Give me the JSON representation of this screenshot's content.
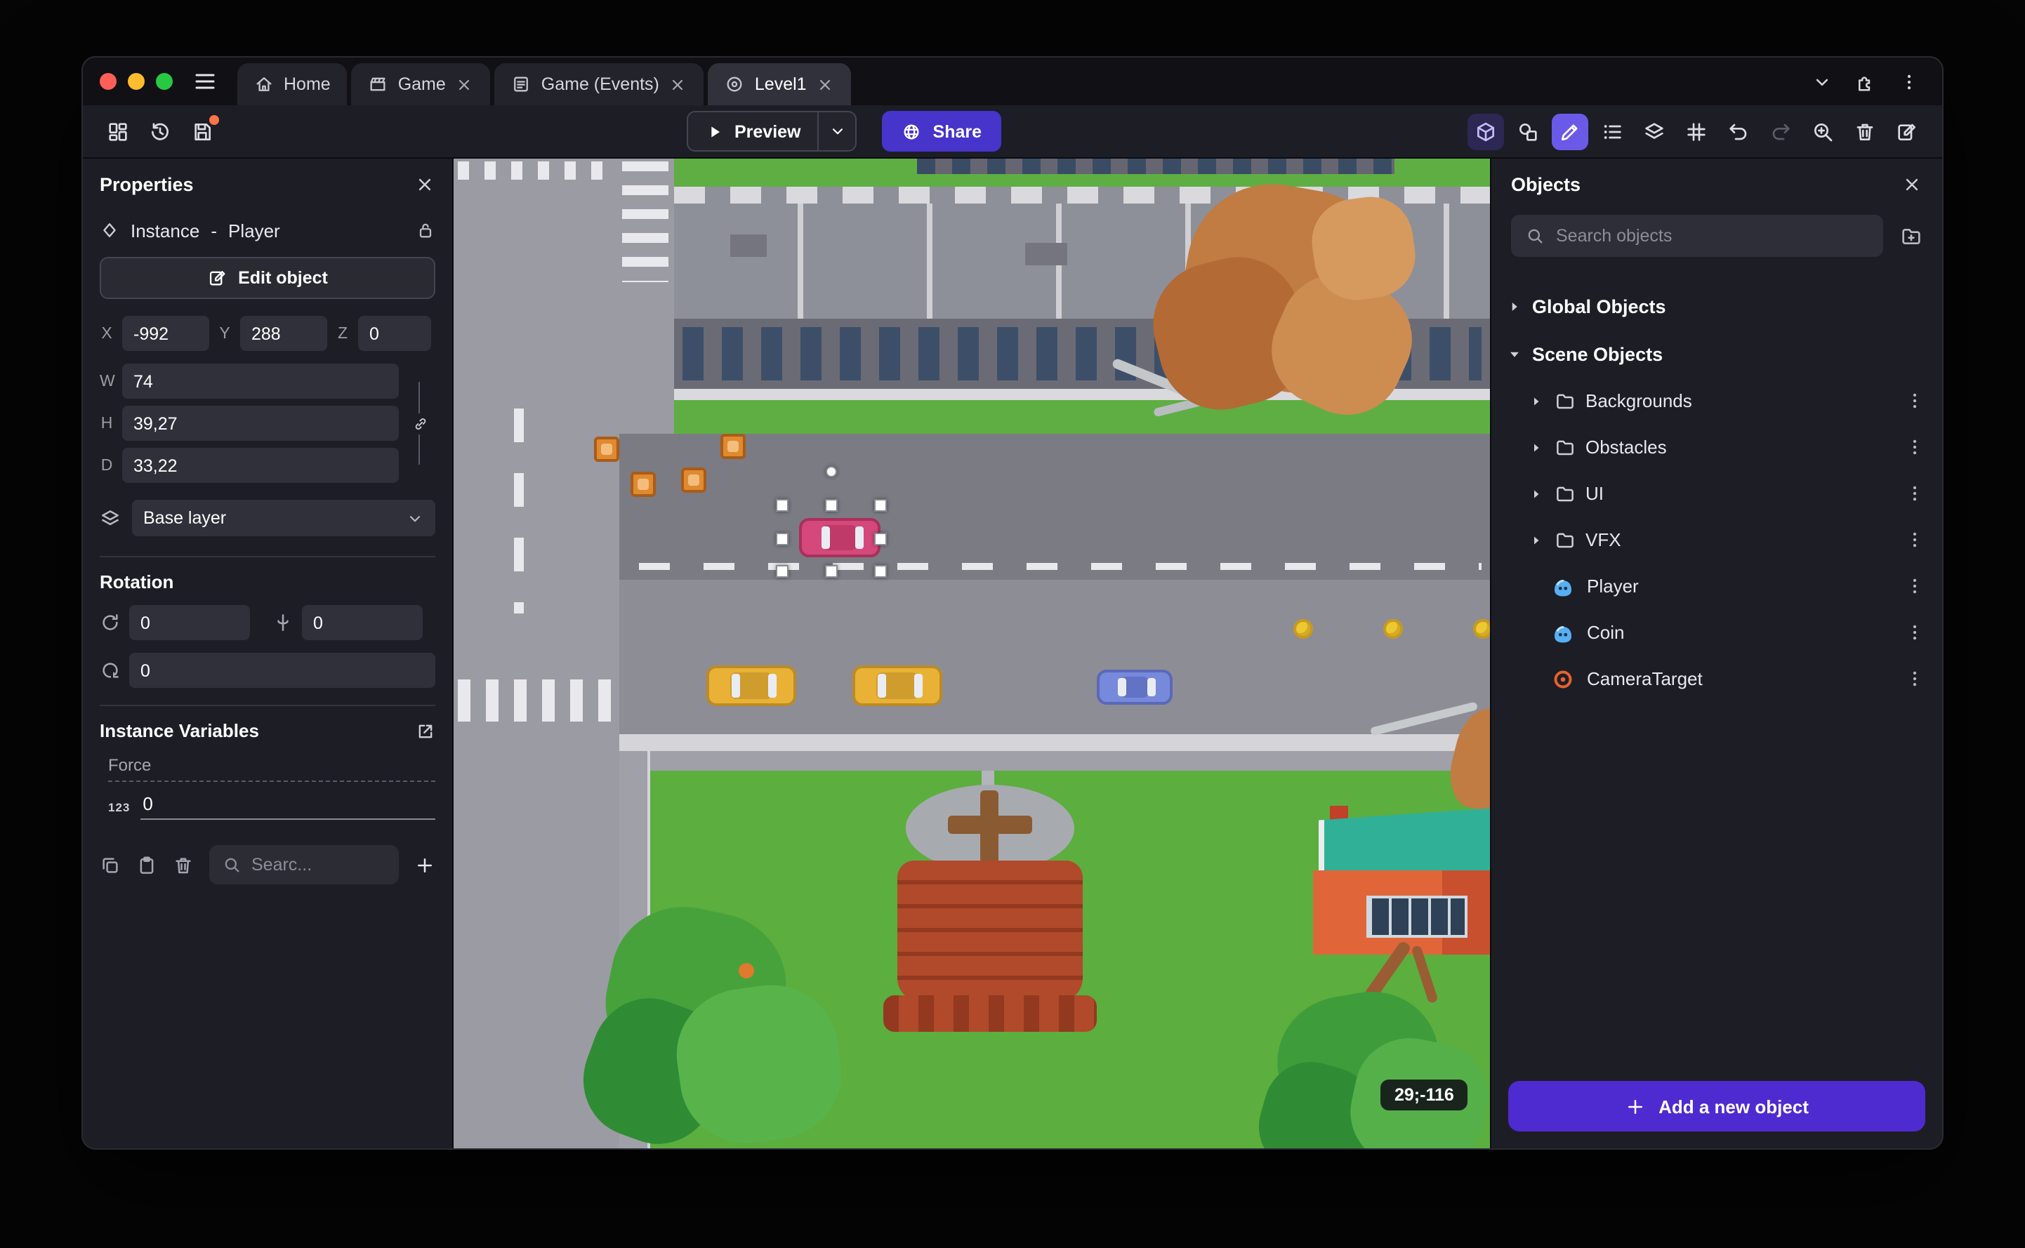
{
  "window": {
    "tabs": [
      {
        "label": "Home"
      },
      {
        "label": "Game"
      },
      {
        "label": "Game (Events)"
      },
      {
        "label": "Level1"
      }
    ]
  },
  "toolbar": {
    "preview_label": "Preview",
    "share_label": "Share"
  },
  "properties_panel": {
    "title": "Properties",
    "instance_label": "Instance",
    "separator": "-",
    "instance_name": "Player",
    "edit_object_label": "Edit object",
    "position": {
      "x_label": "X",
      "x_value": "-992",
      "y_label": "Y",
      "y_value": "288",
      "z_label": "Z",
      "z_value": "0"
    },
    "size": {
      "w_label": "W",
      "w_value": "74",
      "h_label": "H",
      "h_value": "39,27",
      "d_label": "D",
      "d_value": "33,22"
    },
    "layer_value": "Base layer",
    "rotation_title": "Rotation",
    "rotation": {
      "rx_value": "0",
      "ry_value": "0",
      "rz_value": "0"
    },
    "variables_title": "Instance Variables",
    "variable_name": "Force",
    "variable_type_badge": "123",
    "variable_value": "0",
    "search_placeholder": "Searc..."
  },
  "canvas": {
    "cursor_coordinates": "29;-116"
  },
  "objects_panel": {
    "title": "Objects",
    "search_placeholder": "Search objects",
    "global_group_label": "Global Objects",
    "scene_group_label": "Scene Objects",
    "folders": [
      "Backgrounds",
      "Obstacles",
      "UI",
      "VFX"
    ],
    "objects": [
      "Player",
      "Coin",
      "CameraTarget"
    ],
    "add_button_label": "Add a new object"
  },
  "colors": {
    "accent_purple": "#4e2bd1",
    "share_purple": "#4634cb",
    "active_tool_purple": "#6b5ae8",
    "unsaved_dot_orange": "#ff7445",
    "grass_green": "#5cae3e",
    "road_gray": "#8d8d96",
    "selection_handle": "#ffffff",
    "camera_target_orange": "#e8622d"
  }
}
